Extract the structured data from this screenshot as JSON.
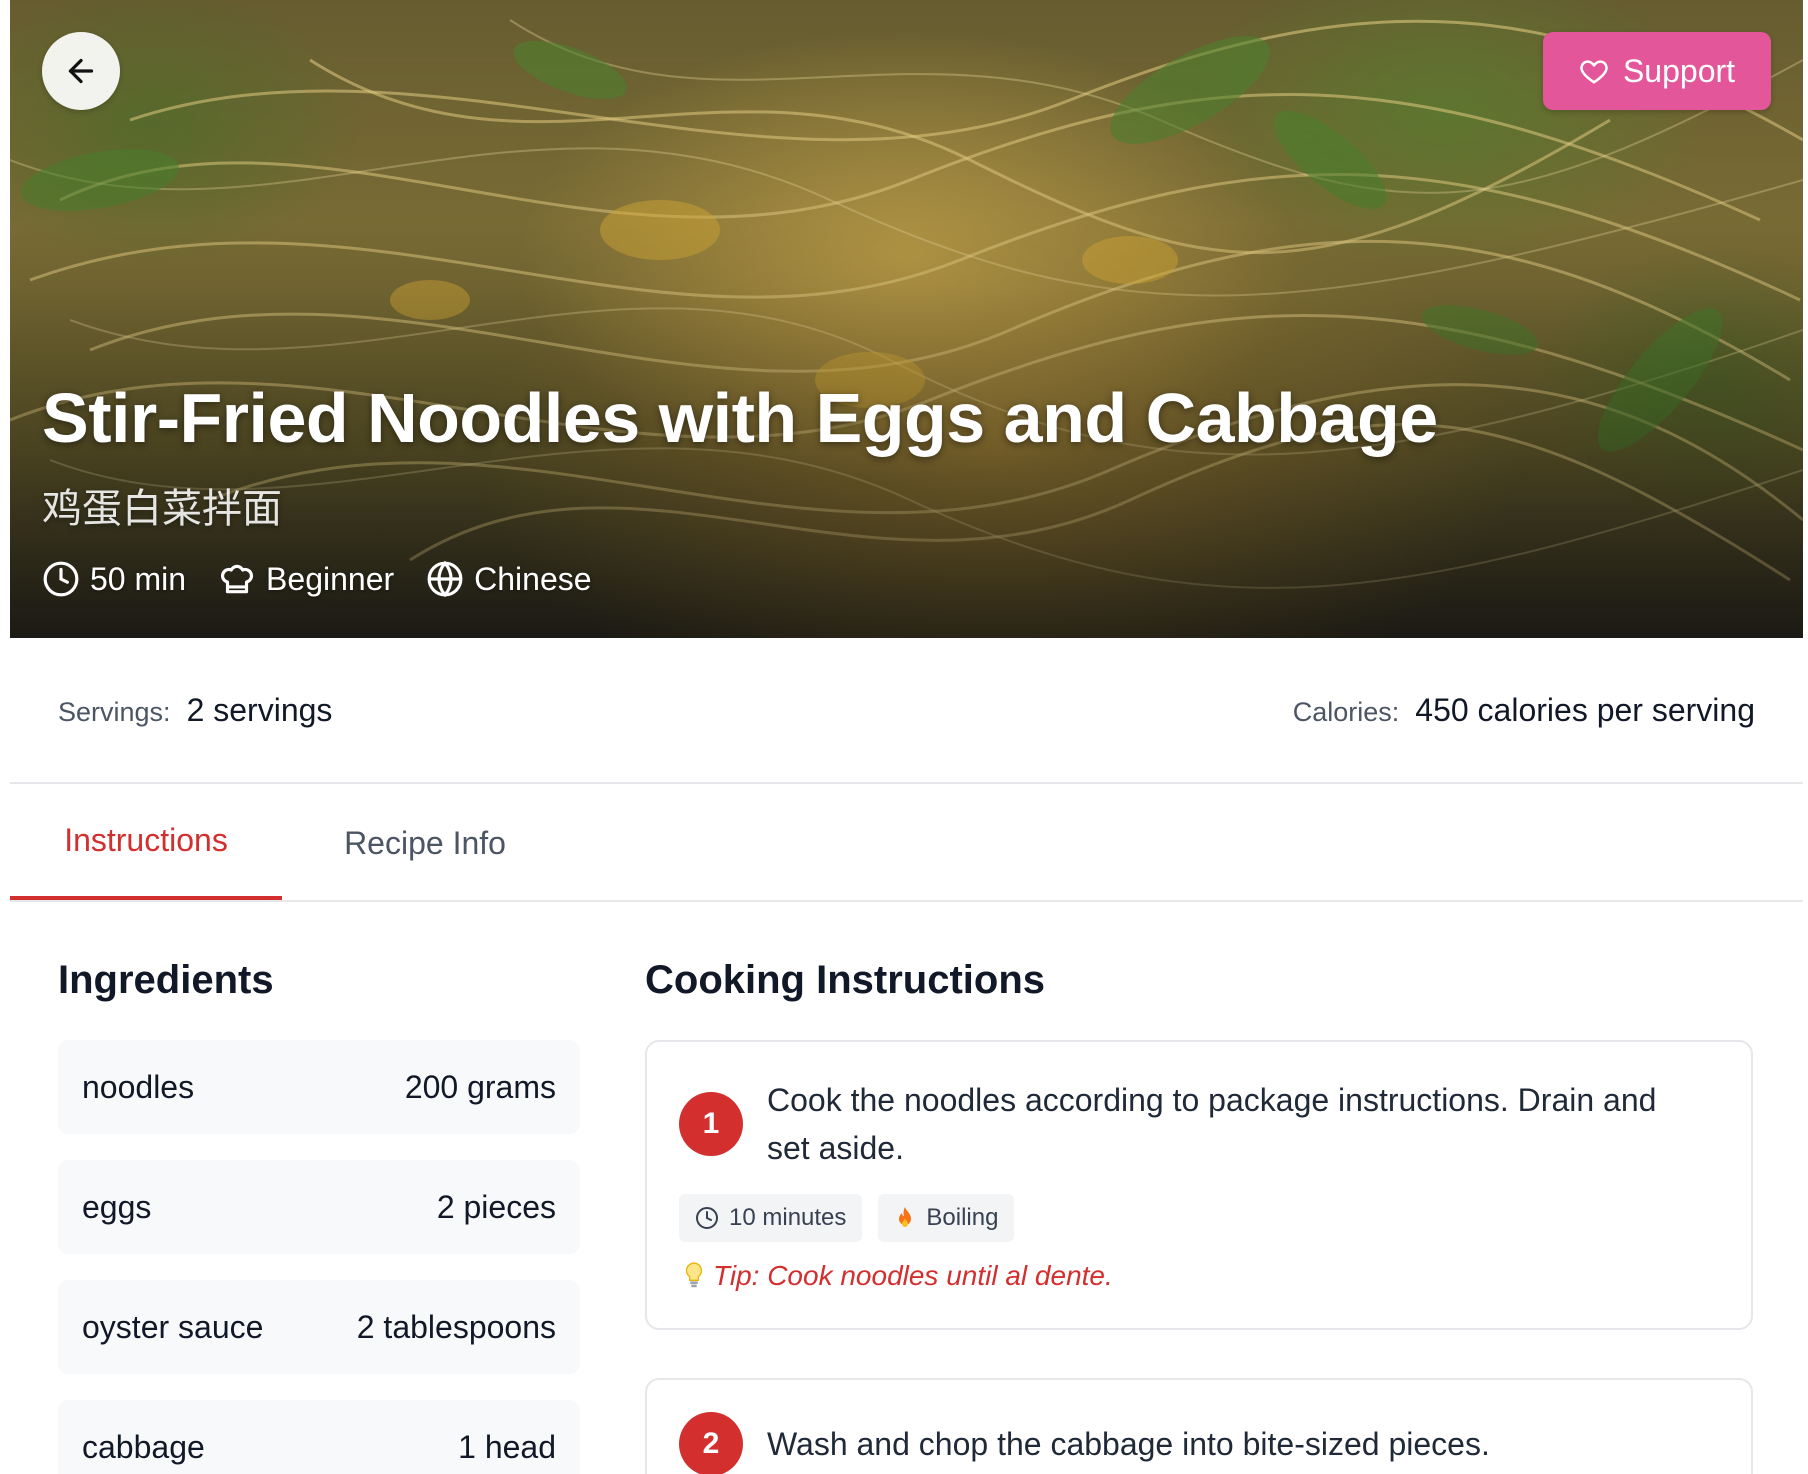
{
  "hero": {
    "title": "Stir-Fried Noodles with Eggs and Cabbage",
    "subtitle": "鸡蛋白菜拌面",
    "meta": [
      {
        "icon": "clock-icon",
        "label": "50 min"
      },
      {
        "icon": "chef-hat-icon",
        "label": "Beginner"
      },
      {
        "icon": "globe-icon",
        "label": "Chinese"
      }
    ],
    "support_label": "Support"
  },
  "stats": {
    "servings_label": "Servings:",
    "servings_value": "2 servings",
    "calories_label": "Calories:",
    "calories_value": "450 calories per serving"
  },
  "tabs": [
    {
      "label": "Instructions",
      "active": true
    },
    {
      "label": "Recipe Info",
      "active": false
    }
  ],
  "ingredients": {
    "title": "Ingredients",
    "items": [
      {
        "name": "noodles",
        "amount": "200 grams"
      },
      {
        "name": "eggs",
        "amount": "2 pieces"
      },
      {
        "name": "oyster sauce",
        "amount": "2 tablespoons"
      },
      {
        "name": "cabbage",
        "amount": "1 head"
      }
    ]
  },
  "instructions": {
    "title": "Cooking Instructions",
    "steps": [
      {
        "number": "1",
        "text": "Cook the noodles according to package instructions. Drain and set aside.",
        "time": "10 minutes",
        "method": "Boiling",
        "tip": "Tip: Cook noodles until al dente."
      },
      {
        "number": "2",
        "text": "Wash and chop the cabbage into bite-sized pieces."
      }
    ]
  },
  "colors": {
    "accent": "#d32f2f",
    "support": "#e4569a",
    "card_bg": "#f8f9fa",
    "border": "#e5e7eb"
  }
}
